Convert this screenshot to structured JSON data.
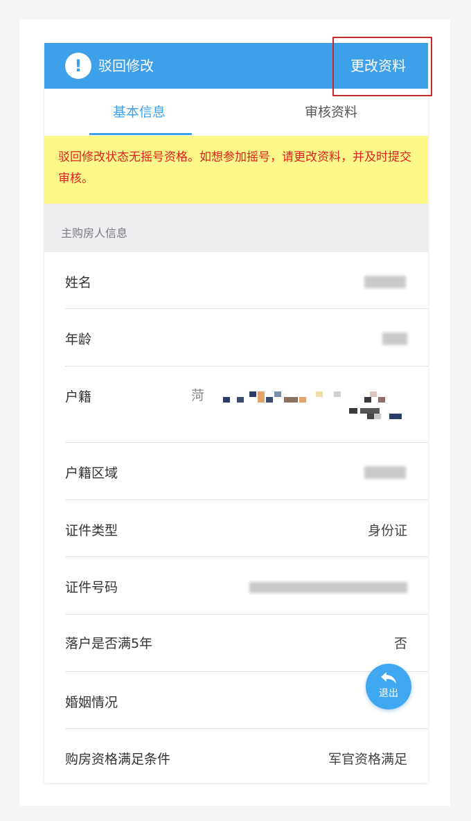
{
  "banner": {
    "title": "驳回修改",
    "edit_label": "更改资料",
    "icon": "exclamation-icon"
  },
  "tabs": [
    {
      "label": "基本信息",
      "active": true
    },
    {
      "label": "审核资料",
      "active": false
    }
  ],
  "notice": "驳回修改状态无摇号资格。如想参加摇号，请更改资料，并及时提交审核。",
  "section": {
    "title": "主购房人信息"
  },
  "rows": [
    {
      "label": "姓名",
      "value": ""
    },
    {
      "label": "年龄",
      "value": ""
    },
    {
      "label": "户籍",
      "value": "菏"
    },
    {
      "label": "户籍区域",
      "value": ""
    },
    {
      "label": "证件类型",
      "value": "身份证"
    },
    {
      "label": "证件号码",
      "value": ""
    },
    {
      "label": "落户是否满5年",
      "value": "否"
    },
    {
      "label": "婚姻情况",
      "value": ""
    },
    {
      "label": "购房资格满足条件",
      "value": "军官资格满足"
    }
  ],
  "exit_button": {
    "label": "退出",
    "icon": "return-arrow-icon"
  },
  "colors": {
    "primary": "#3fa0ea",
    "notice_bg": "#fcf98a",
    "notice_text": "#e02020",
    "highlight_box": "#c32a2f"
  }
}
